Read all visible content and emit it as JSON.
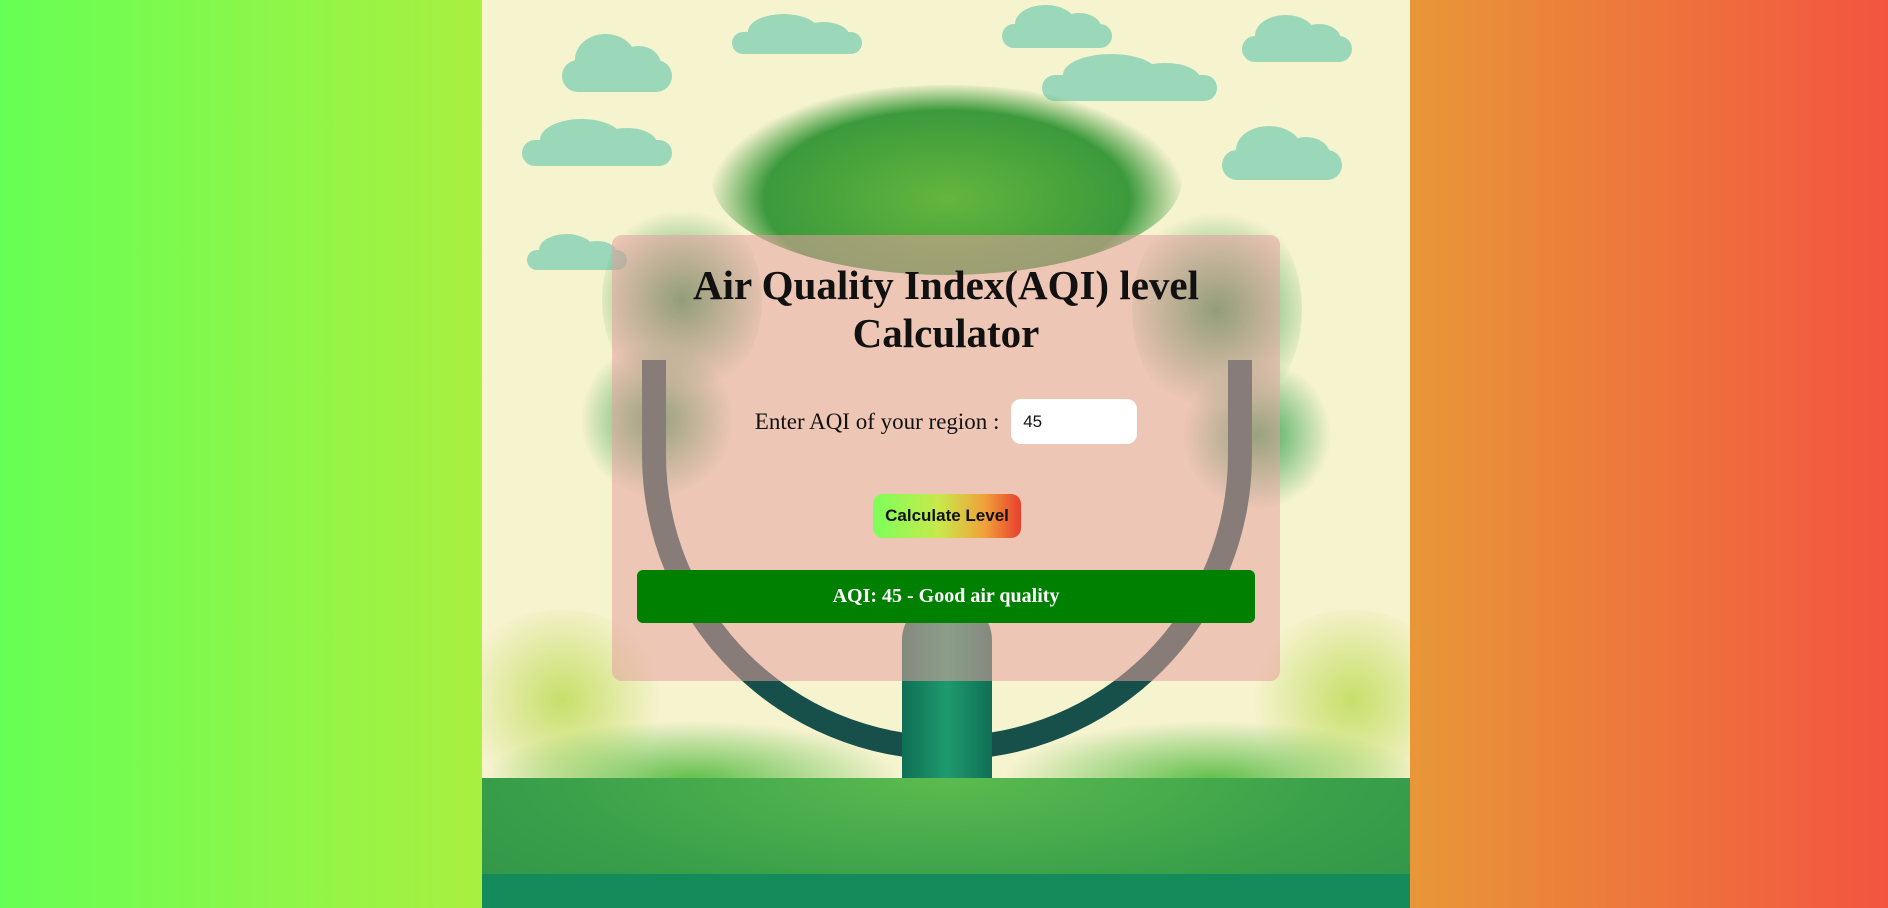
{
  "app": {
    "title": "Air Quality Index(AQI) level Calculator"
  },
  "form": {
    "label": "Enter AQI of your region :",
    "input_value": "45",
    "button_label": "Calculate Level"
  },
  "result": {
    "text": "AQI: 45 - Good air quality",
    "color": "#008000"
  },
  "colors": {
    "gradient_left": "#66ff55",
    "gradient_right": "#f35440",
    "card_overlay": "#e6a0a0",
    "button_gradient": [
      "#7cff5a",
      "#c9e84a",
      "#f0a23a",
      "#e8402e"
    ]
  },
  "background_image": {
    "icon": "tree-in-globe-illustration"
  }
}
